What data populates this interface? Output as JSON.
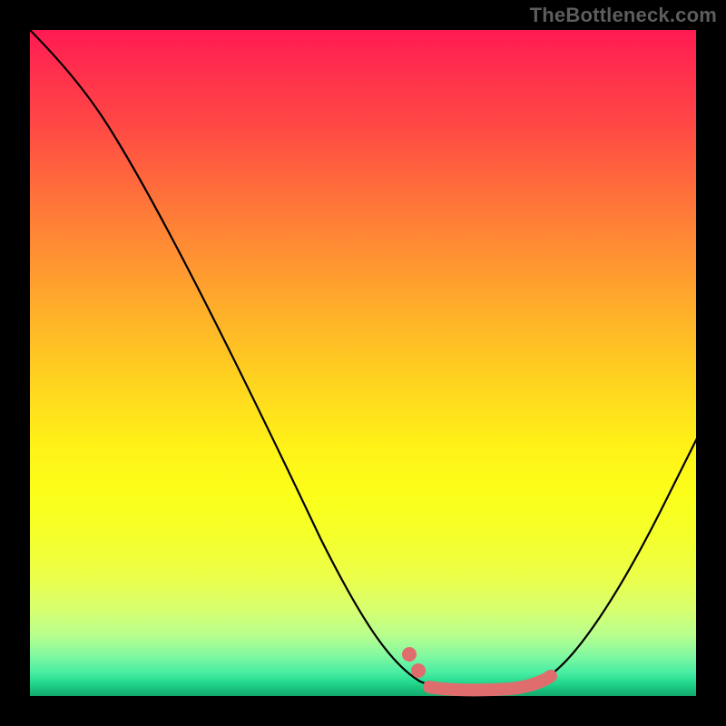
{
  "watermark": "TheBottleneck.com",
  "colors": {
    "background": "#000000",
    "curve": "#000000",
    "highlight": "#e06d6d"
  },
  "chart_data": {
    "type": "line",
    "title": "",
    "xlabel": "",
    "ylabel": "",
    "xlim": [
      0,
      100
    ],
    "ylim": [
      0,
      100
    ],
    "grid": false,
    "series": [
      {
        "name": "bottleneck-curve",
        "x": [
          0,
          5,
          10,
          15,
          20,
          25,
          30,
          35,
          40,
          45,
          50,
          52,
          54,
          56,
          58,
          60,
          62,
          64,
          66,
          68,
          70,
          72,
          75,
          78,
          82,
          86,
          90,
          94,
          98,
          100
        ],
        "y": [
          100,
          98,
          95,
          91,
          86,
          80,
          73,
          65,
          56,
          47,
          38,
          33,
          28,
          23,
          18,
          13,
          9,
          5,
          2,
          0,
          0,
          0,
          0,
          1,
          3,
          7,
          14,
          23,
          33,
          40
        ]
      }
    ],
    "annotations": {
      "optimal_zone": {
        "x_start": 62,
        "x_end": 76
      },
      "markers": [
        {
          "x": 58,
          "y": 7
        },
        {
          "x": 60,
          "y": 4
        }
      ]
    }
  }
}
